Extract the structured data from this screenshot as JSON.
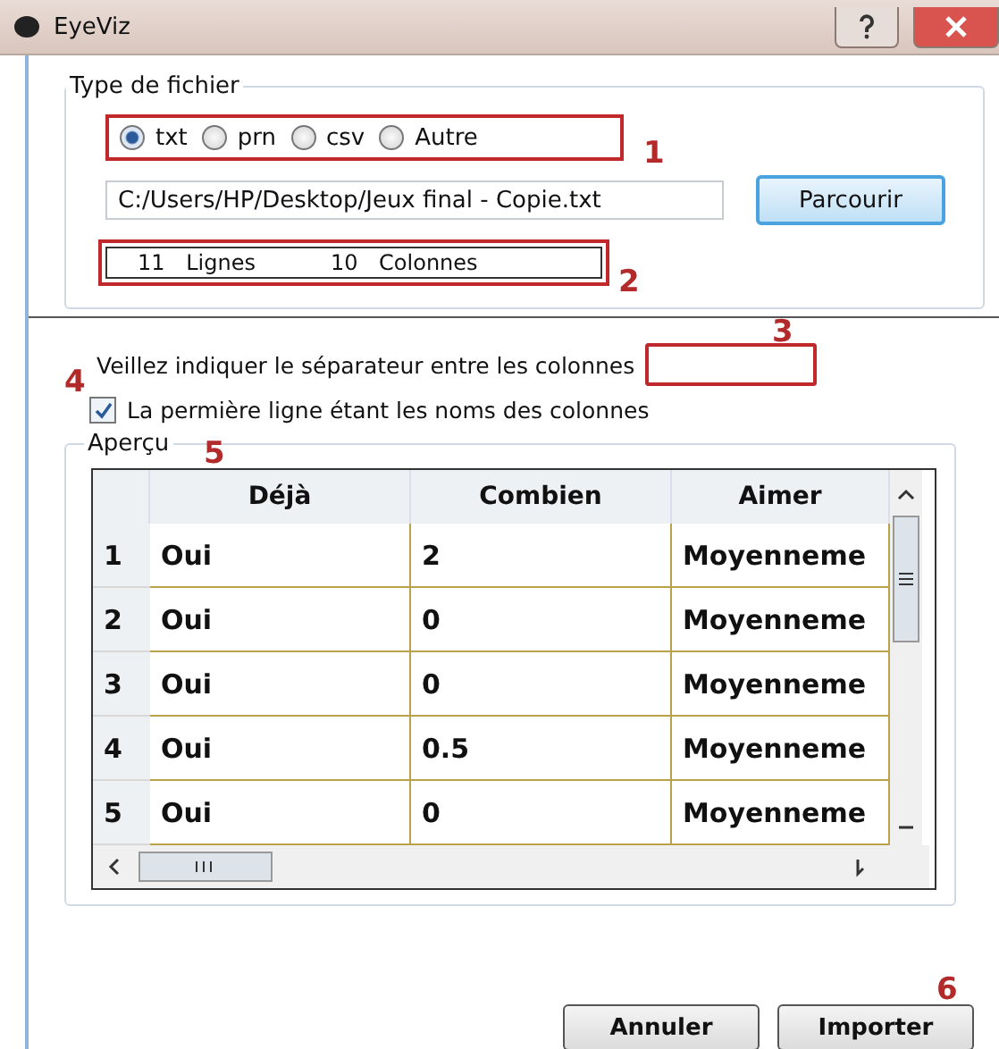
{
  "window": {
    "title": "EyeViz"
  },
  "file_type": {
    "title": "Type de fichier",
    "options": [
      {
        "label": "txt",
        "selected": true
      },
      {
        "label": "prn",
        "selected": false
      },
      {
        "label": "csv",
        "selected": false
      },
      {
        "label": "Autre",
        "selected": false
      }
    ],
    "path": "C:/Users/HP/Desktop/Jeux final - Copie.txt",
    "browse_button": "Parcourir",
    "counts": [
      {
        "value": "11",
        "label": "Lignes"
      },
      {
        "value": "10",
        "label": "Colonnes"
      }
    ]
  },
  "separator": {
    "label": "Veillez indiquer le séparateur entre les colonnes"
  },
  "header_row": {
    "label": "La permière ligne étant les noms des colonnes",
    "checked": true
  },
  "preview": {
    "title": "Aperçu",
    "columns": [
      "Déjà",
      "Combien",
      "Aimer"
    ],
    "rows": [
      {
        "index": "1",
        "cells": [
          "Oui",
          "2",
          "Moyenneme"
        ]
      },
      {
        "index": "2",
        "cells": [
          "Oui",
          "0",
          "Moyenneme"
        ]
      },
      {
        "index": "3",
        "cells": [
          "Oui",
          "0",
          "Moyenneme"
        ]
      },
      {
        "index": "4",
        "cells": [
          "Oui",
          "0.5",
          "Moyenneme"
        ]
      },
      {
        "index": "5",
        "cells": [
          "Oui",
          "0",
          "Moyenneme"
        ]
      }
    ]
  },
  "buttons": [
    "Annuler",
    "Importer"
  ],
  "annotations": [
    "1",
    "2",
    "3",
    "4",
    "5",
    "6"
  ]
}
